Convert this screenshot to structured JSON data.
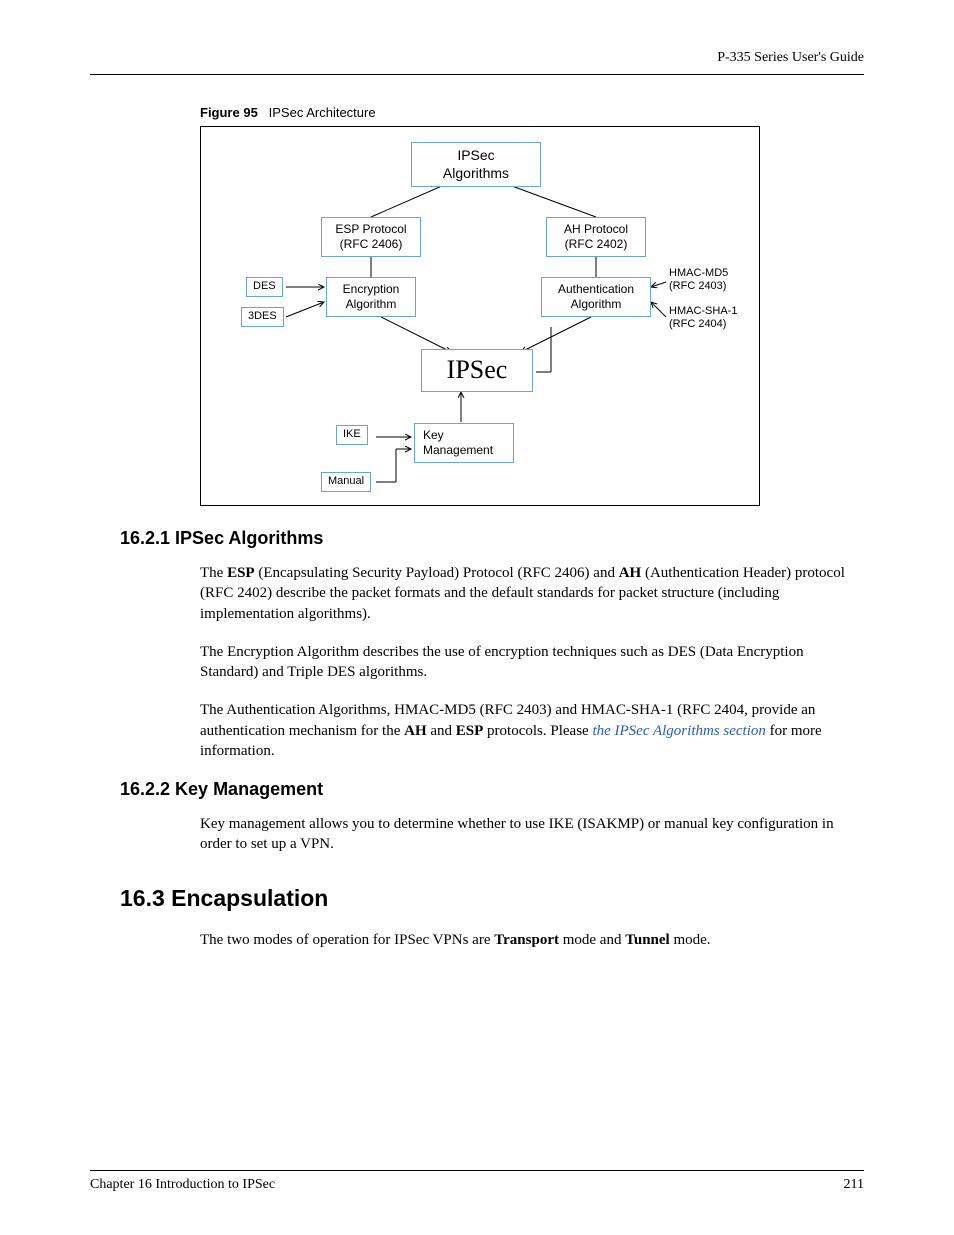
{
  "header": {
    "running": "P-335 Series User's Guide"
  },
  "figure": {
    "label": "Figure 95",
    "title": "IPSec Architecture",
    "boxes": {
      "algos": "IPSec\nAlgorithms",
      "esp": "ESP Protocol\n(RFC 2406)",
      "ah": "AH Protocol\n(RFC 2402)",
      "des": "DES",
      "tdes": "3DES",
      "encalg": "Encryption\nAlgorithm",
      "authalg": "Authentication\nAlgorithm",
      "ipsec": "IPSec",
      "ike": "IKE",
      "manual": "Manual",
      "keymgmt": "Key\nManagement",
      "hmacmd5": "HMAC-MD5\n(RFC 2403)",
      "hmacsha1": "HMAC-SHA-1\n(RFC 2404)"
    }
  },
  "sections": {
    "s1621": {
      "heading": "16.2.1  IPSec Algorithms",
      "p1_a": "The ",
      "p1_esp": "ESP",
      "p1_b": " (Encapsulating Security Payload) Protocol (RFC 2406) and ",
      "p1_ah": "AH",
      "p1_c": " (Authentication Header) protocol (RFC 2402) describe the packet formats and the default standards for packet structure (including implementation algorithms).",
      "p2": "The Encryption Algorithm describes the use of encryption techniques such as DES (Data Encryption Standard) and Triple DES algorithms.",
      "p3_a": "The Authentication Algorithms, HMAC-MD5 (RFC 2403) and HMAC-SHA-1 (RFC 2404, provide an authentication mechanism for the ",
      "p3_ah": "AH",
      "p3_b": " and ",
      "p3_esp": "ESP",
      "p3_c": " protocols. Please  ",
      "p3_link": "the IPSec Algorithms section",
      "p3_d": "  for more information."
    },
    "s1622": {
      "heading": "16.2.2  Key Management",
      "p1": "Key management allows you to determine whether to use IKE (ISAKMP) or manual key configuration in order to set up a VPN."
    },
    "s163": {
      "heading": "16.3  Encapsulation",
      "p1_a": "The two modes of operation for IPSec VPNs are ",
      "p1_t": "Transport",
      "p1_b": " mode and ",
      "p1_tu": "Tunnel",
      "p1_c": " mode."
    }
  },
  "footer": {
    "chapter": "Chapter 16 Introduction to IPSec",
    "page": "211"
  },
  "chart_data": {
    "type": "diagram",
    "title": "IPSec Architecture",
    "nodes": [
      {
        "id": "algos",
        "label": "IPSec Algorithms"
      },
      {
        "id": "esp",
        "label": "ESP Protocol (RFC 2406)"
      },
      {
        "id": "ah",
        "label": "AH Protocol (RFC 2402)"
      },
      {
        "id": "des",
        "label": "DES"
      },
      {
        "id": "tdes",
        "label": "3DES"
      },
      {
        "id": "encalg",
        "label": "Encryption Algorithm"
      },
      {
        "id": "authalg",
        "label": "Authentication Algorithm"
      },
      {
        "id": "hmacmd5",
        "label": "HMAC-MD5 (RFC 2403)"
      },
      {
        "id": "hmacsha1",
        "label": "HMAC-SHA-1 (RFC 2404)"
      },
      {
        "id": "ipsec",
        "label": "IPSec"
      },
      {
        "id": "ike",
        "label": "IKE"
      },
      {
        "id": "manual",
        "label": "Manual"
      },
      {
        "id": "keymgmt",
        "label": "Key Management"
      }
    ],
    "edges": [
      {
        "from": "esp",
        "to": "algos"
      },
      {
        "from": "ah",
        "to": "algos"
      },
      {
        "from": "des",
        "to": "encalg"
      },
      {
        "from": "tdes",
        "to": "encalg"
      },
      {
        "from": "encalg",
        "to": "esp"
      },
      {
        "from": "hmacmd5",
        "to": "authalg"
      },
      {
        "from": "hmacsha1",
        "to": "authalg"
      },
      {
        "from": "authalg",
        "to": "ah"
      },
      {
        "from": "encalg",
        "to": "ipsec"
      },
      {
        "from": "authalg",
        "to": "ipsec"
      },
      {
        "from": "ike",
        "to": "keymgmt"
      },
      {
        "from": "manual",
        "to": "keymgmt"
      },
      {
        "from": "keymgmt",
        "to": "ipsec"
      }
    ]
  }
}
